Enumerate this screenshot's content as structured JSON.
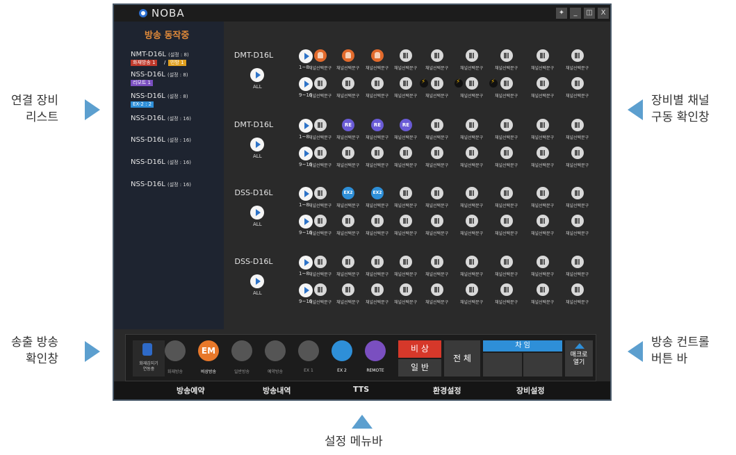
{
  "callouts": {
    "left_top": [
      "연결 장비",
      "리스트"
    ],
    "left_bottom": [
      "송출 방송",
      "확인창"
    ],
    "right_top": [
      "장비별 채널",
      "구동 확인창"
    ],
    "right_bottom": [
      "방송 컨트롤",
      "버튼 바"
    ],
    "bottom": "설정 메뉴바"
  },
  "app": {
    "logo": "NOBA",
    "window_buttons": [
      "pin-icon",
      "minimize-icon",
      "restore-icon",
      "X"
    ]
  },
  "sidebar": {
    "title": "방송 동작중",
    "devices": [
      {
        "name": "NMT-D16L",
        "cfg": "(설정 : 8)",
        "tags": [
          "화재방송 1",
          "/",
          "민방 1"
        ]
      },
      {
        "name": "NSS-D16L",
        "cfg": "(설정 : 8)",
        "tags": [
          "리모트 1"
        ]
      },
      {
        "name": "NSS-D16L",
        "cfg": "(설정 : 8)",
        "tags": [
          "EX-2 : 2"
        ]
      },
      {
        "name": "NSS-D16L",
        "cfg": "(설정 : 16)",
        "tags": []
      },
      {
        "name": "NSS-D16L",
        "cfg": "(설정 : 16)",
        "tags": []
      },
      {
        "name": "NSS-D16L",
        "cfg": "(설정 : 16)",
        "tags": []
      },
      {
        "name": "NSS-D16L",
        "cfg": "(설정 : 16)",
        "tags": []
      }
    ]
  },
  "main": {
    "groups": [
      {
        "name": "DMT-D16L",
        "rows": [
          "1~8",
          "9~16"
        ]
      },
      {
        "name": "DMT-D16L",
        "rows": [
          "1~8",
          "9~16"
        ]
      },
      {
        "name": "DSS-D16L",
        "rows": [
          "1~8",
          "9~16"
        ]
      },
      {
        "name": "DSS-D16L",
        "rows": [
          "1~8",
          "9~16"
        ]
      }
    ],
    "all_label": "ALL",
    "channel_label": "채널선택문구"
  },
  "control_bar": {
    "status_label": "화재감지기\n연동중",
    "buttons": [
      {
        "label": "화재방송",
        "icon": "fire-icon"
      },
      {
        "label": "EM",
        "sub": "비상방송",
        "icon": "em-icon"
      },
      {
        "label": "일반방송",
        "icon": "speaker-icon"
      },
      {
        "label": "예약방송",
        "icon": "clock-icon"
      },
      {
        "label": "EX 1",
        "icon": "ex1-icon"
      },
      {
        "label": "EX 2",
        "icon": "ex2-icon"
      },
      {
        "label": "REMOTE",
        "icon": "mic-icon"
      }
    ],
    "emergency": "비 상",
    "normal": "일 반",
    "all": "전 체",
    "chime": "차 임",
    "macro": "매크로\n열기"
  },
  "menubar": [
    "방송예약",
    "방송내역",
    "TTS",
    "환경설정",
    "장비설정"
  ]
}
